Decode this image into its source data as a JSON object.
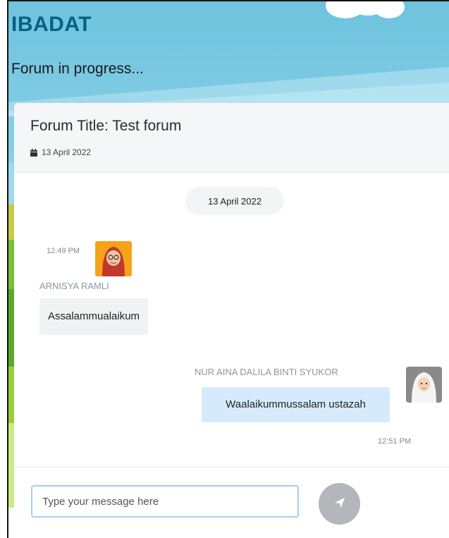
{
  "app": {
    "brand": "IBADAT",
    "subtitle": "Forum in progress..."
  },
  "forum": {
    "title": "Forum Title: Test forum",
    "date": "13 April 2022"
  },
  "chat": {
    "date_divider": "13 April 2022",
    "messages": [
      {
        "sender": "ARNISYA RAMLI",
        "time": "12:49 PM",
        "text": "Assalammualaikum",
        "side": "left"
      },
      {
        "sender": "NUR AINA DALILA BINTI SYUKOR",
        "time": "12:51 PM",
        "text": "Waalaikummussalam ustazah",
        "side": "right"
      }
    ]
  },
  "composer": {
    "placeholder": "Type your message here",
    "send_icon": "paper-plane-icon"
  },
  "colors": {
    "brand": "#0a5f86",
    "sky": "#8fd2e8",
    "bubble_right": "#d5ebfb",
    "bubble_left": "#f1f2f4",
    "avatar_left_bg": "#f7a21b"
  }
}
